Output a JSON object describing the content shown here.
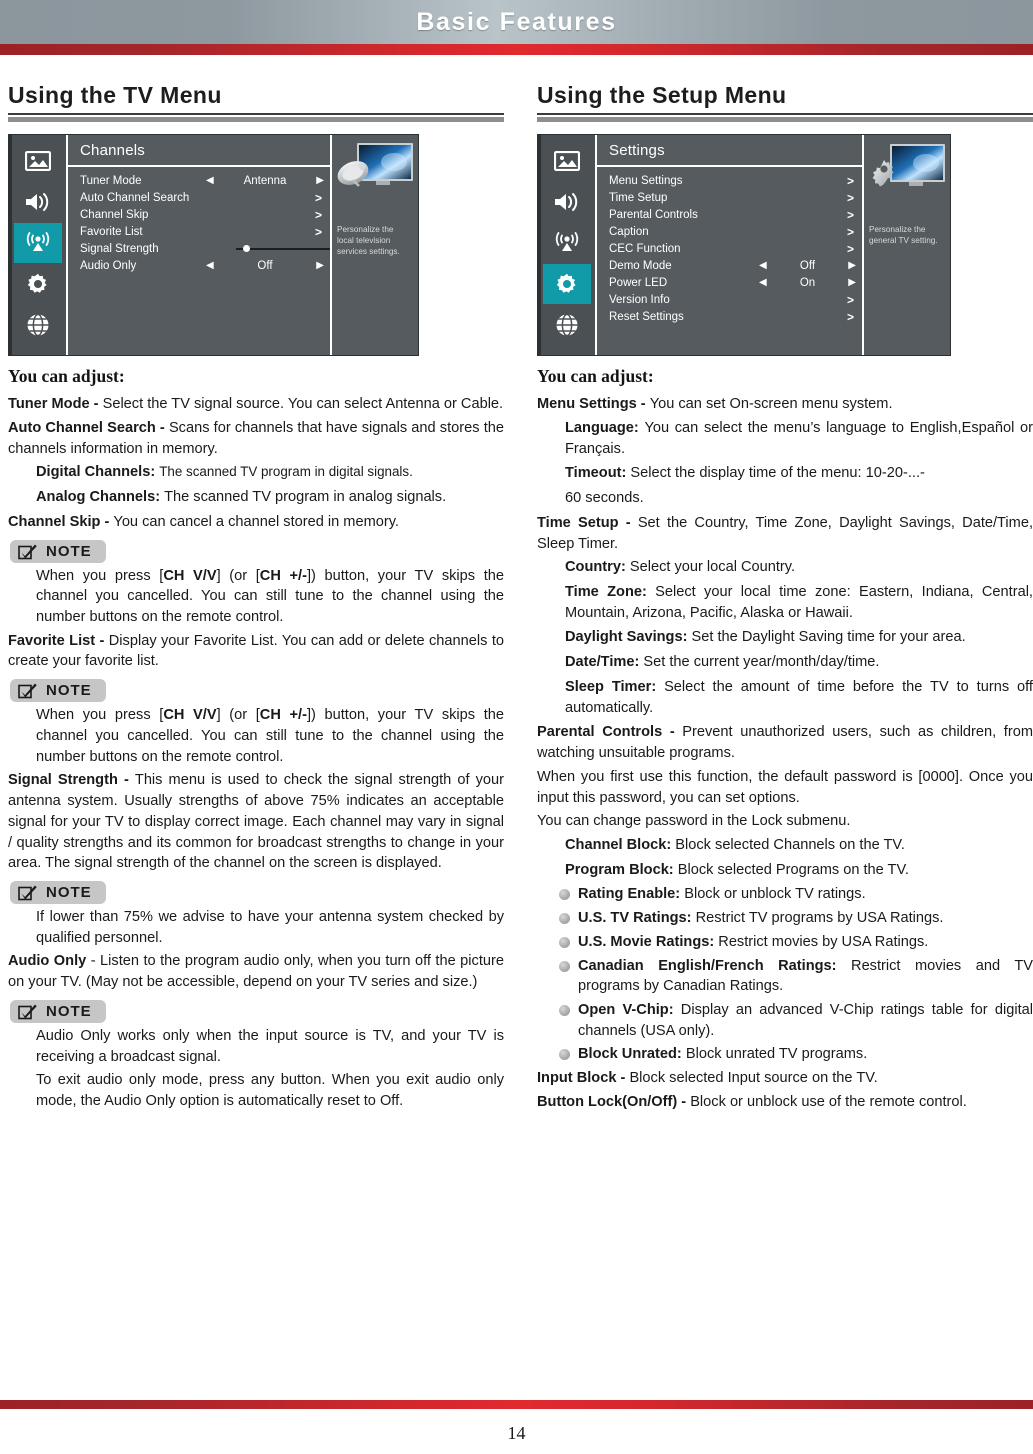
{
  "banner": {
    "title": "Basic Features"
  },
  "footer": {
    "page_number": "14"
  },
  "left": {
    "section_title": "Using the TV Menu",
    "osd": {
      "menu_title": "Channels",
      "rail_icons": [
        "picture-icon",
        "audio-icon",
        "antenna-icon",
        "settings-icon",
        "network-icon"
      ],
      "active_rail_index": 2,
      "rows": [
        {
          "label": "Tuner Mode",
          "type": "selector",
          "value": "Antenna"
        },
        {
          "label": "Auto Channel Search",
          "type": "submenu",
          "value": ">"
        },
        {
          "label": "Channel Skip",
          "type": "submenu",
          "value": ">"
        },
        {
          "label": "Favorite List",
          "type": "submenu",
          "value": ">"
        },
        {
          "label": "Signal Strength",
          "type": "slider",
          "value": "5"
        },
        {
          "label": "Audio Only",
          "type": "selector",
          "value": "Off"
        }
      ],
      "aside_text": "Personalize the local television services settings."
    },
    "you_can_adjust": "You can adjust:",
    "blocks": [
      {
        "kind": "para",
        "bold": "Tuner Mode - ",
        "text": "Select the TV signal source. You can select Antenna or Cable."
      },
      {
        "kind": "para",
        "bold": "Auto Channel Search - ",
        "text": "Scans for channels that have signals and stores the channels information in memory."
      },
      {
        "kind": "indent-tight",
        "bold": "Digital Channels: ",
        "text": "The scanned TV program in digital signals."
      },
      {
        "kind": "indent",
        "bold": "Analog Channels: ",
        "text": "The scanned TV program in analog signals."
      },
      {
        "kind": "para",
        "bold": "Channel Skip - ",
        "text": "You can cancel a channel stored in memory."
      },
      {
        "kind": "note",
        "text_parts": [
          "When you press [",
          "CH V/V",
          "] (or [",
          "CH +/-",
          "]) button, your TV skips the channel you cancelled. You can still tune to the channel using the number buttons on the remote control."
        ]
      },
      {
        "kind": "para",
        "bold": "Favorite List - ",
        "text": "Display your Favorite List. You can add or delete channels to create your favorite list."
      },
      {
        "kind": "note",
        "text_parts": [
          "When you press [",
          "CH V/V",
          "] (or [",
          "CH +/-",
          "]) button, your TV skips the channel you cancelled. You can still tune to the channel using the number buttons on the remote control."
        ]
      },
      {
        "kind": "para",
        "bold": "Signal Strength - ",
        "text": "This menu is used to check the signal strength of your antenna system. Usually strengths of above 75% indicates an acceptable signal for your TV to display correct image. Each channel may vary in signal / quality strengths and its common for broadcast strengths to change in your area. The signal strength of the channel on the screen is displayed."
      },
      {
        "kind": "note-plain",
        "text": "If lower than 75% we advise to have your antenna system checked by qualified personnel."
      },
      {
        "kind": "para",
        "bold": "Audio Only",
        "text": " - Listen to the program audio only, when you turn off the picture on your TV. (May not be accessible, depend on your TV series and size.)"
      },
      {
        "kind": "note-plain",
        "text": "Audio Only works only when the input source is TV, and your TV is receiving a broadcast signal."
      },
      {
        "kind": "note-plain",
        "text": "To exit audio only mode, press any button. When you exit audio only mode, the Audio Only option is automatically reset to Off."
      }
    ],
    "note_label": "NOTE"
  },
  "right": {
    "section_title": "Using the Setup Menu",
    "osd": {
      "menu_title": "Settings",
      "rail_icons": [
        "picture-icon",
        "audio-icon",
        "antenna-icon",
        "settings-icon",
        "network-icon"
      ],
      "active_rail_index": 3,
      "rows": [
        {
          "label": "Menu Settings",
          "type": "submenu",
          "value": ">"
        },
        {
          "label": "Time Setup",
          "type": "submenu",
          "value": ">"
        },
        {
          "label": "Parental Controls",
          "type": "submenu",
          "value": ">"
        },
        {
          "label": "Caption",
          "type": "submenu",
          "value": ">"
        },
        {
          "label": "CEC Function",
          "type": "submenu",
          "value": ">"
        },
        {
          "label": "Demo Mode",
          "type": "selector",
          "value": "Off"
        },
        {
          "label": "Power LED",
          "type": "selector",
          "value": "On"
        },
        {
          "label": "Version Info",
          "type": "submenu",
          "value": ">"
        },
        {
          "label": "Reset Settings",
          "type": "submenu",
          "value": ">"
        }
      ],
      "aside_text": "Personalize the general TV setting."
    },
    "you_can_adjust": "You can adjust:",
    "blocks": [
      {
        "kind": "para",
        "bold": "Menu Settings - ",
        "text": "You can set On-screen menu system."
      },
      {
        "kind": "indent",
        "bold": "Language: ",
        "text": "You can select the menu’s language to English,Español or Français."
      },
      {
        "kind": "indent",
        "bold": "Timeout: ",
        "text": "Select the display time of the menu: 10-20-...-"
      },
      {
        "kind": "indent-plain",
        "text": "60 seconds."
      },
      {
        "kind": "para",
        "bold": "Time Setup - ",
        "text": "Set the Country, Time Zone, Daylight Savings, Date/Time, Sleep Timer."
      },
      {
        "kind": "indent",
        "bold": "Country: ",
        "text": "Select your local Country."
      },
      {
        "kind": "indent",
        "bold": "Time Zone: ",
        "text": "Select your local time zone: Eastern, Indiana, Central, Mountain, Arizona, Pacific, Alaska or Hawaii."
      },
      {
        "kind": "indent",
        "bold": "Daylight Savings: ",
        "text": "Set the Daylight Saving time for your area."
      },
      {
        "kind": "indent",
        "bold": "Date/Time: ",
        "text": "Set the current year/month/day/time."
      },
      {
        "kind": "indent",
        "bold": "Sleep Timer: ",
        "text": "Select the amount of time before the TV to turns off automatically."
      },
      {
        "kind": "para",
        "bold": "Parental Controls - ",
        "text": "Prevent unauthorized users, such as children, from watching unsuitable programs."
      },
      {
        "kind": "para-plain",
        "text": "When you first use this function, the default password is [0000]. Once you input this password, you can set options."
      },
      {
        "kind": "para-plain",
        "text": "You can change password in the Lock submenu."
      },
      {
        "kind": "indent",
        "bold": "Channel Block: ",
        "text": "Block selected Channels on the TV."
      },
      {
        "kind": "indent",
        "bold": "Program Block: ",
        "text": "Block selected Programs on the TV."
      },
      {
        "kind": "bullet",
        "bold": "Rating Enable: ",
        "text": "Block or unblock TV ratings."
      },
      {
        "kind": "bullet",
        "bold": "U.S. TV Ratings: ",
        "text": "Restrict TV programs by USA Ratings."
      },
      {
        "kind": "bullet",
        "bold": "U.S. Movie Ratings: ",
        "text": "Restrict movies by USA Ratings."
      },
      {
        "kind": "bullet",
        "bold": "Canadian English/French Ratings: ",
        "text": "Restrict movies and TV programs by Canadian Ratings."
      },
      {
        "kind": "bullet",
        "bold": "Open V-Chip: ",
        "text": "Display an advanced V-Chip ratings table for digital channels (USA only)."
      },
      {
        "kind": "bullet",
        "bold": "Block Unrated: ",
        "text": "Block unrated TV programs."
      },
      {
        "kind": "para",
        "bold": "Input Block - ",
        "text": "Block selected Input source on the TV."
      },
      {
        "kind": "para",
        "bold": "Button Lock(On/Off) - ",
        "text": "Block or unblock use of the remote control."
      }
    ]
  },
  "colors": {
    "banner_gray": "#8b969d",
    "accent_red": "#d6282c",
    "osd_bg": "#555b5e",
    "osd_rail": "#4a5053",
    "osd_active": "#119aa8"
  }
}
